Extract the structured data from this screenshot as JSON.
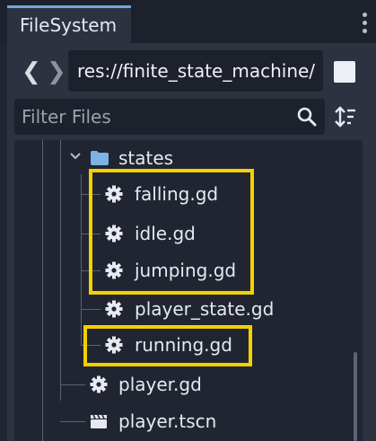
{
  "dock": {
    "tab_label": "FileSystem"
  },
  "path_bar": {
    "back_glyph": "❮",
    "forward_glyph": "❯",
    "path": "res://finite_state_machine/"
  },
  "filter": {
    "placeholder": "Filter Files"
  },
  "tree": {
    "folder_label": "states",
    "state_files": [
      "falling.gd",
      "idle.gd",
      "jumping.gd",
      "player_state.gd",
      "running.gd"
    ],
    "root_files": [
      {
        "label": "player.gd",
        "icon": "gear-icon"
      },
      {
        "label": "player.tscn",
        "icon": "scene-icon"
      }
    ]
  },
  "colors": {
    "background": "#202531",
    "panel": "#2c3240",
    "field": "#1c212b",
    "folder": "#7cb3e3",
    "highlight": "#f5d000",
    "text": "#e6e9ef",
    "placeholder": "#9aa2ae"
  }
}
